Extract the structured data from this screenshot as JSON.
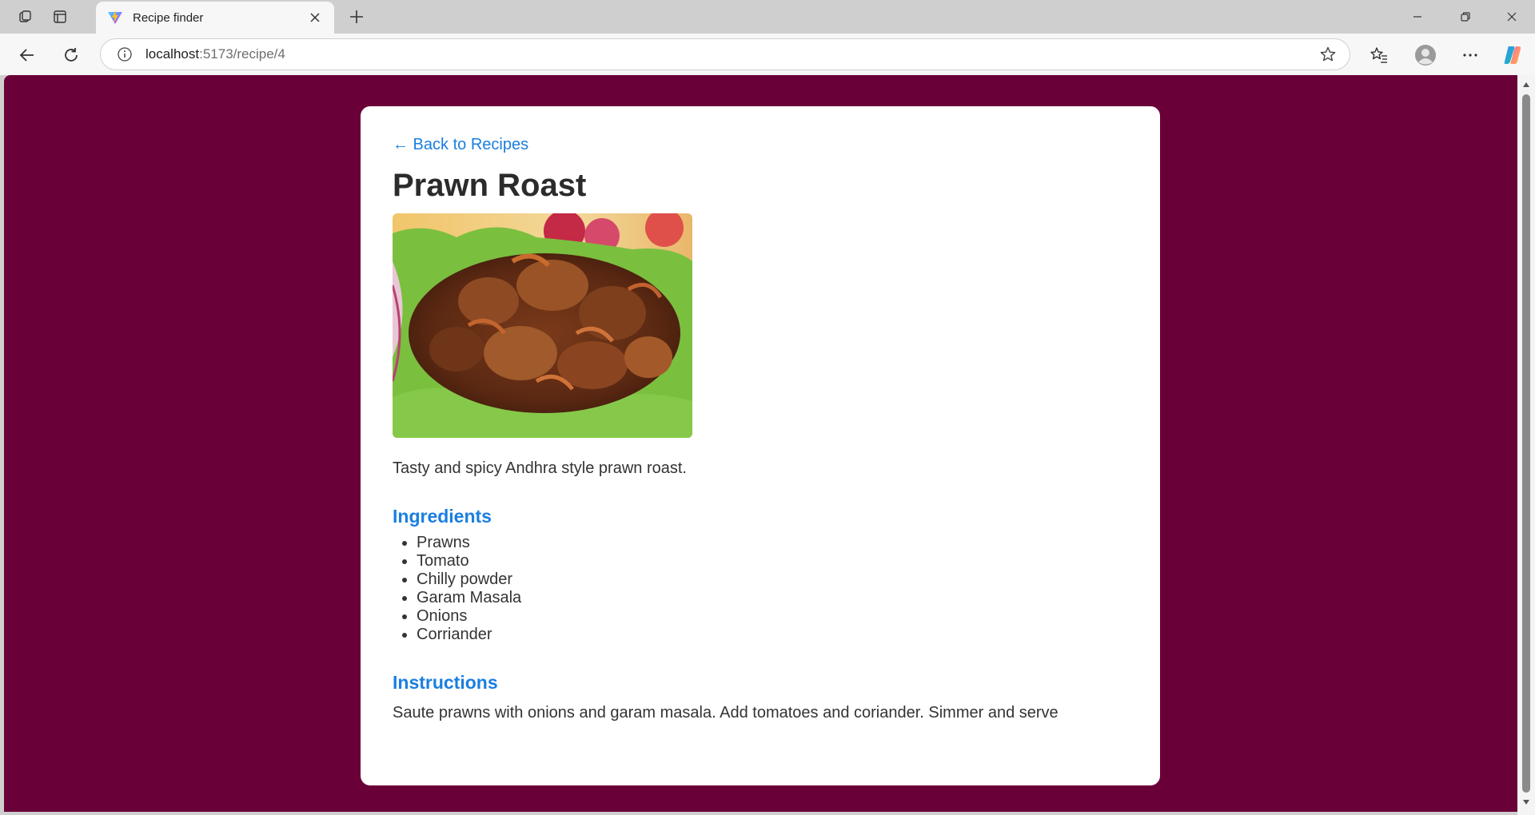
{
  "browser": {
    "tab_title": "Recipe finder",
    "url_host": "localhost",
    "url_rest": ":5173/recipe/4"
  },
  "page": {
    "back_label": "← Back to Recipes",
    "title": "Prawn Roast",
    "image_alt": "Prawn Roast",
    "description": "Tasty and spicy Andhra style prawn roast.",
    "ingredients_heading": "Ingredients",
    "ingredients": [
      "Prawns",
      "Tomato",
      "Chilly powder",
      "Garam Masala",
      "Onions",
      "Corriander"
    ],
    "instructions_heading": "Instructions",
    "instructions": "Saute prawns with onions and garam masala. Add tomatoes and coriander. Simmer and serve"
  },
  "colors": {
    "page_background": "#6a0038",
    "card_background": "#ffffff",
    "accent": "#1a7fe0",
    "body_text": "#333333"
  },
  "icons": {
    "tab_strip": [
      "workspaces-icon",
      "vertical-tabs-icon"
    ],
    "tab": [
      "vite-favicon-icon",
      "close-icon"
    ],
    "window": [
      "minimize-icon",
      "restore-icon",
      "close-window-icon"
    ],
    "toolbar": [
      "back-arrow-icon",
      "reload-icon",
      "info-icon",
      "star-icon",
      "favorites-icon",
      "profile-avatar-icon",
      "more-icon",
      "copilot-icon"
    ]
  }
}
